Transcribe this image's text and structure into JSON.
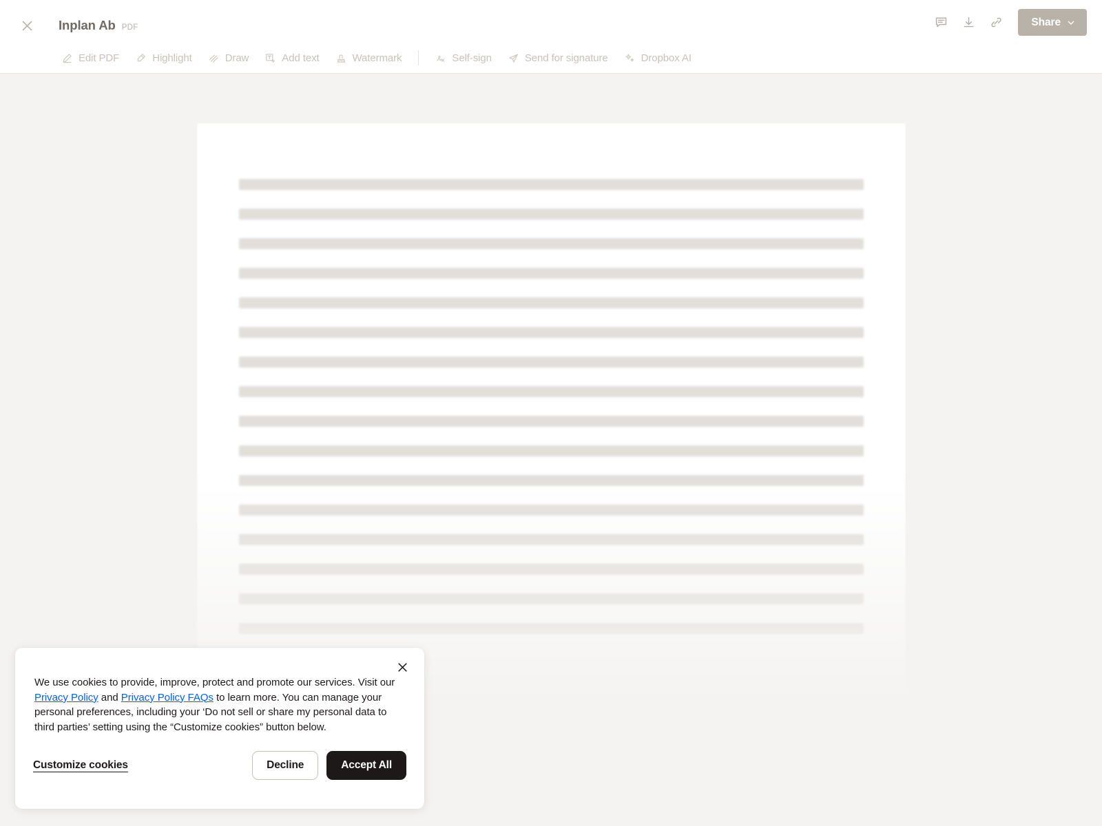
{
  "header": {
    "close_icon": "close-icon",
    "document_title": "Inplan Ab",
    "file_type": "PDF",
    "actions": [
      {
        "name": "comment-icon",
        "label": "Comment"
      },
      {
        "name": "download-icon",
        "label": "Download"
      },
      {
        "name": "link-icon",
        "label": "Copy link"
      }
    ],
    "share_label": "Share",
    "share_chevron": "chevron-down-icon",
    "share_bg_color": "#b9b2a9"
  },
  "toolbar": {
    "items": [
      {
        "label": "Edit PDF",
        "icon": "pencil-icon"
      },
      {
        "label": "Highlight",
        "icon": "highlighter-icon"
      },
      {
        "label": "Draw",
        "icon": "scribble-icon"
      },
      {
        "label": "Add text",
        "icon": "text-box-icon"
      },
      {
        "label": "Watermark",
        "icon": "stamp-icon"
      },
      {
        "label": "Self-sign",
        "icon": "signature-icon"
      },
      {
        "label": "Send for signature",
        "icon": "paper-plane-icon"
      },
      {
        "label": "Dropbox AI",
        "icon": "sparkle-icon"
      }
    ],
    "divider_after_index": 4
  },
  "document": {
    "state": "loading-skeleton",
    "skeleton_line_count": 16,
    "page_background": "#ffffff",
    "viewer_background": "#f4f3f1"
  },
  "cookie_banner": {
    "close_icon": "close-icon",
    "text_part_1": "We use cookies to provide, improve, protect and promote our services. Visit our ",
    "link_privacy_policy": "Privacy Policy",
    "text_part_2": " and ",
    "link_privacy_faqs": "Privacy Policy FAQs",
    "text_part_3": " to learn more. You can manage your personal preferences, including your ‘Do not sell or share my personal data to third parties’ setting using the “Customize cookies” button below.",
    "customize_label": "Customize cookies",
    "decline_label": "Decline",
    "accept_label": "Accept All",
    "link_color": "#0061fe",
    "accept_bg_color": "#1e1919"
  }
}
